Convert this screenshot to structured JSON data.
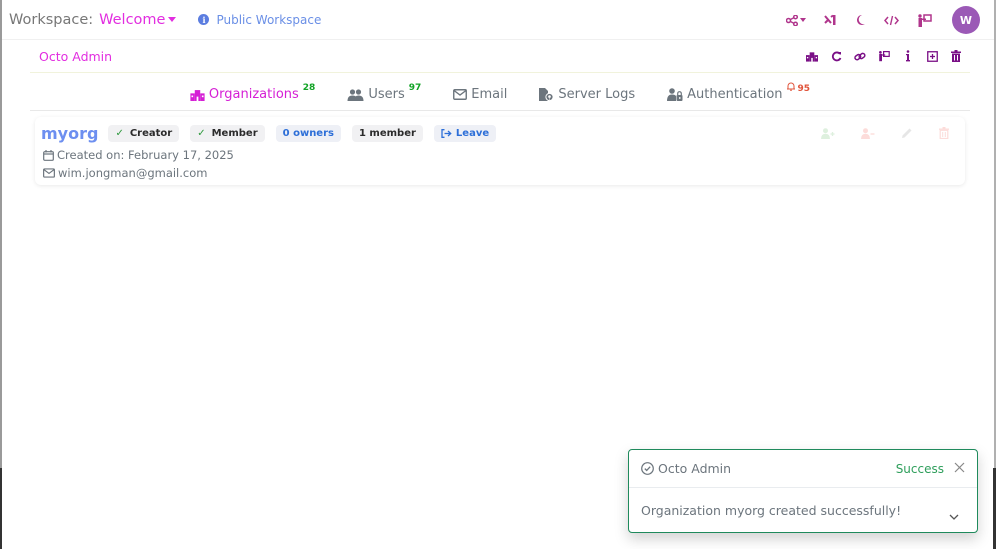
{
  "topbar": {
    "workspace_label": "Workspace:",
    "workspace_value": "Welcome",
    "public_workspace": "Public Workspace",
    "avatar_initial": "W",
    "icons": [
      "share-icon",
      "vscode-icon",
      "moon-icon",
      "code-icon",
      "presenter-icon"
    ]
  },
  "admin": {
    "title": "Octo Admin",
    "actions": [
      "organizations-icon",
      "refresh-icon",
      "link-icon",
      "presenter-icon",
      "info-icon",
      "add-square-icon",
      "trash-icon"
    ]
  },
  "tabs": [
    {
      "label": "Organizations",
      "badge": "28",
      "icon": "building-icon",
      "active": true
    },
    {
      "label": "Users",
      "badge": "97",
      "icon": "users-icon",
      "active": false
    },
    {
      "label": "Email",
      "badge": "",
      "icon": "envelope-icon",
      "active": false
    },
    {
      "label": "Server Logs",
      "badge": "",
      "icon": "file-search-icon",
      "active": false
    },
    {
      "label": "Authentication",
      "badge": "95",
      "icon": "user-lock-icon",
      "active": false
    }
  ],
  "organization": {
    "name": "myorg",
    "badges": {
      "creator": "Creator",
      "member": "Member",
      "owners": "0 owners",
      "members": "1 member",
      "leave": "Leave"
    },
    "created": "Created on: February 17, 2025",
    "email": "wim.jongman@gmail.com",
    "actions": [
      "add-user-icon",
      "remove-user-icon",
      "edit-icon",
      "delete-icon"
    ]
  },
  "toast": {
    "title": "Octo Admin",
    "status": "Success",
    "message": "Organization myorg created successfully!"
  },
  "colors": {
    "accent": "#e22ee0",
    "icon_purple": "#b0358c",
    "admin_icon": "#7a0f86",
    "link_blue": "#6d8ff0",
    "success_green": "#2e9e5b",
    "badge_green": "#11a325",
    "badge_red": "#e0533a",
    "avatar": "#9b59b6"
  }
}
